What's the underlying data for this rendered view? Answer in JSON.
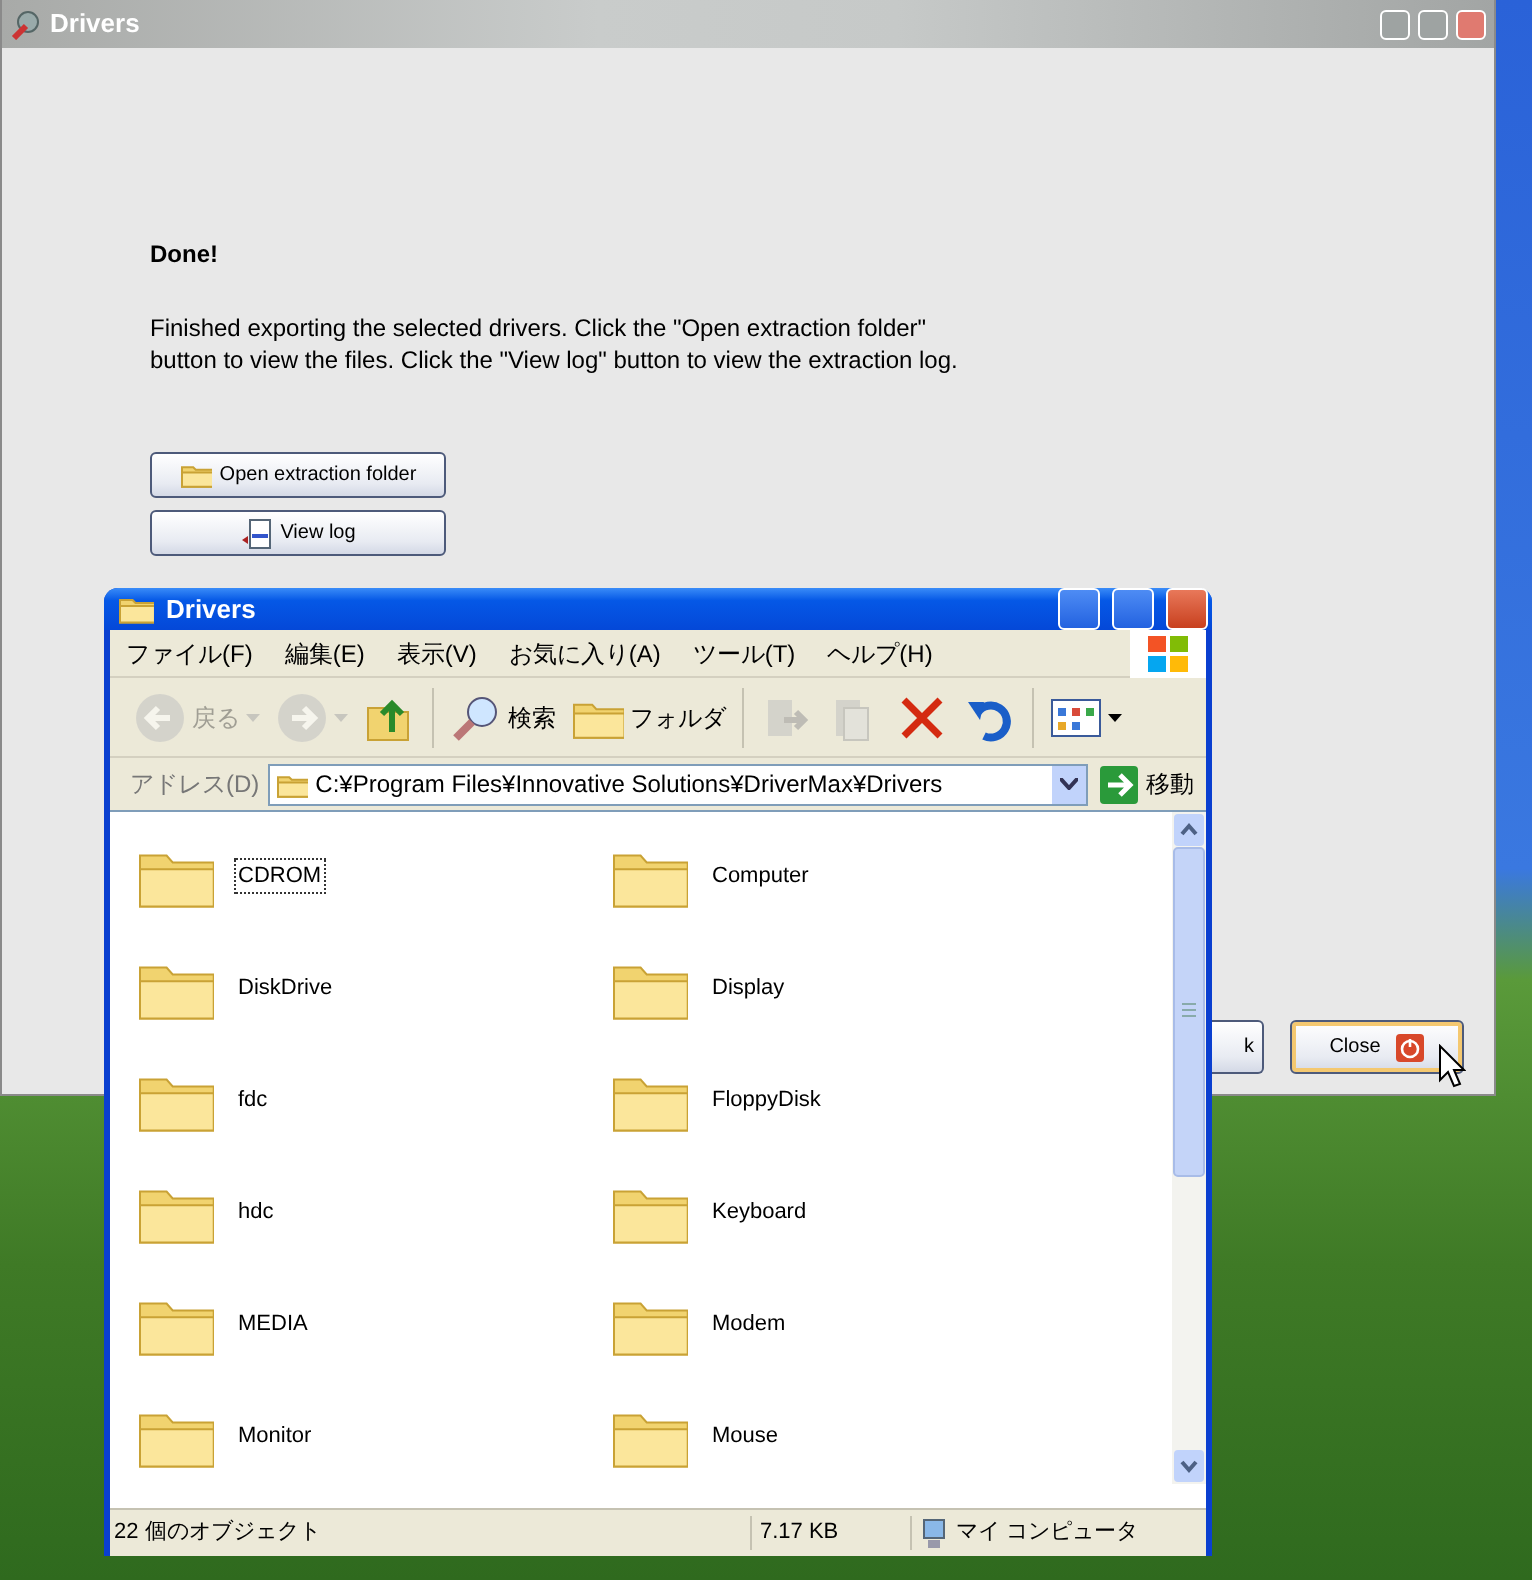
{
  "dialog": {
    "title": "Drivers",
    "heading": "Done!",
    "message": "Finished exporting the selected drivers. Click the \"Open extraction folder\" button to view the files. Click the \"View log\" button to view the extraction log.",
    "buttons": [
      {
        "label": "Open extraction folder",
        "kind": "folder"
      },
      {
        "label": "View log",
        "kind": "log"
      }
    ],
    "footer_buttons": [
      {
        "label": "k",
        "kind": "plain"
      },
      {
        "label": "Close",
        "kind": "close"
      }
    ]
  },
  "explorer": {
    "title": "Drivers",
    "menu": [
      "ファイル(F)",
      "編集(E)",
      "表示(V)",
      "お気に入り(A)",
      "ツール(T)",
      "ヘルプ(H)"
    ],
    "toolbar": [
      {
        "kind": "back",
        "label": "戻る",
        "disabled": true
      },
      {
        "kind": "forward",
        "disabled": true
      },
      {
        "kind": "up",
        "disabled": false
      },
      {
        "kind": "search",
        "label": "検索",
        "disabled": false
      },
      {
        "kind": "folders",
        "label": "フォルダ",
        "disabled": false
      },
      {
        "kind": "move",
        "disabled": true
      },
      {
        "kind": "copy",
        "disabled": true
      },
      {
        "kind": "delete",
        "disabled": false
      },
      {
        "kind": "undo",
        "disabled": false
      },
      {
        "kind": "views",
        "disabled": false
      }
    ],
    "address": {
      "label": "アドレス(D)",
      "value": "C:¥Program Files¥Innovative Solutions¥DriverMax¥Drivers",
      "go": "移動"
    },
    "files": [
      {
        "name": "CDROM",
        "focused": true
      },
      {
        "name": "Computer",
        "focused": false
      },
      {
        "name": "DiskDrive",
        "focused": false
      },
      {
        "name": "Display",
        "focused": false
      },
      {
        "name": "fdc",
        "focused": false
      },
      {
        "name": "FloppyDisk",
        "focused": false
      },
      {
        "name": "hdc",
        "focused": false
      },
      {
        "name": "Keyboard",
        "focused": false
      },
      {
        "name": "MEDIA",
        "focused": false
      },
      {
        "name": "Modem",
        "focused": false
      },
      {
        "name": "Monitor",
        "focused": false
      },
      {
        "name": "Mouse",
        "focused": false
      }
    ],
    "status_bar": {
      "count": "22 個のオブジェクト",
      "size": "7.17 KB",
      "location": "マイ コンピュータ"
    }
  }
}
